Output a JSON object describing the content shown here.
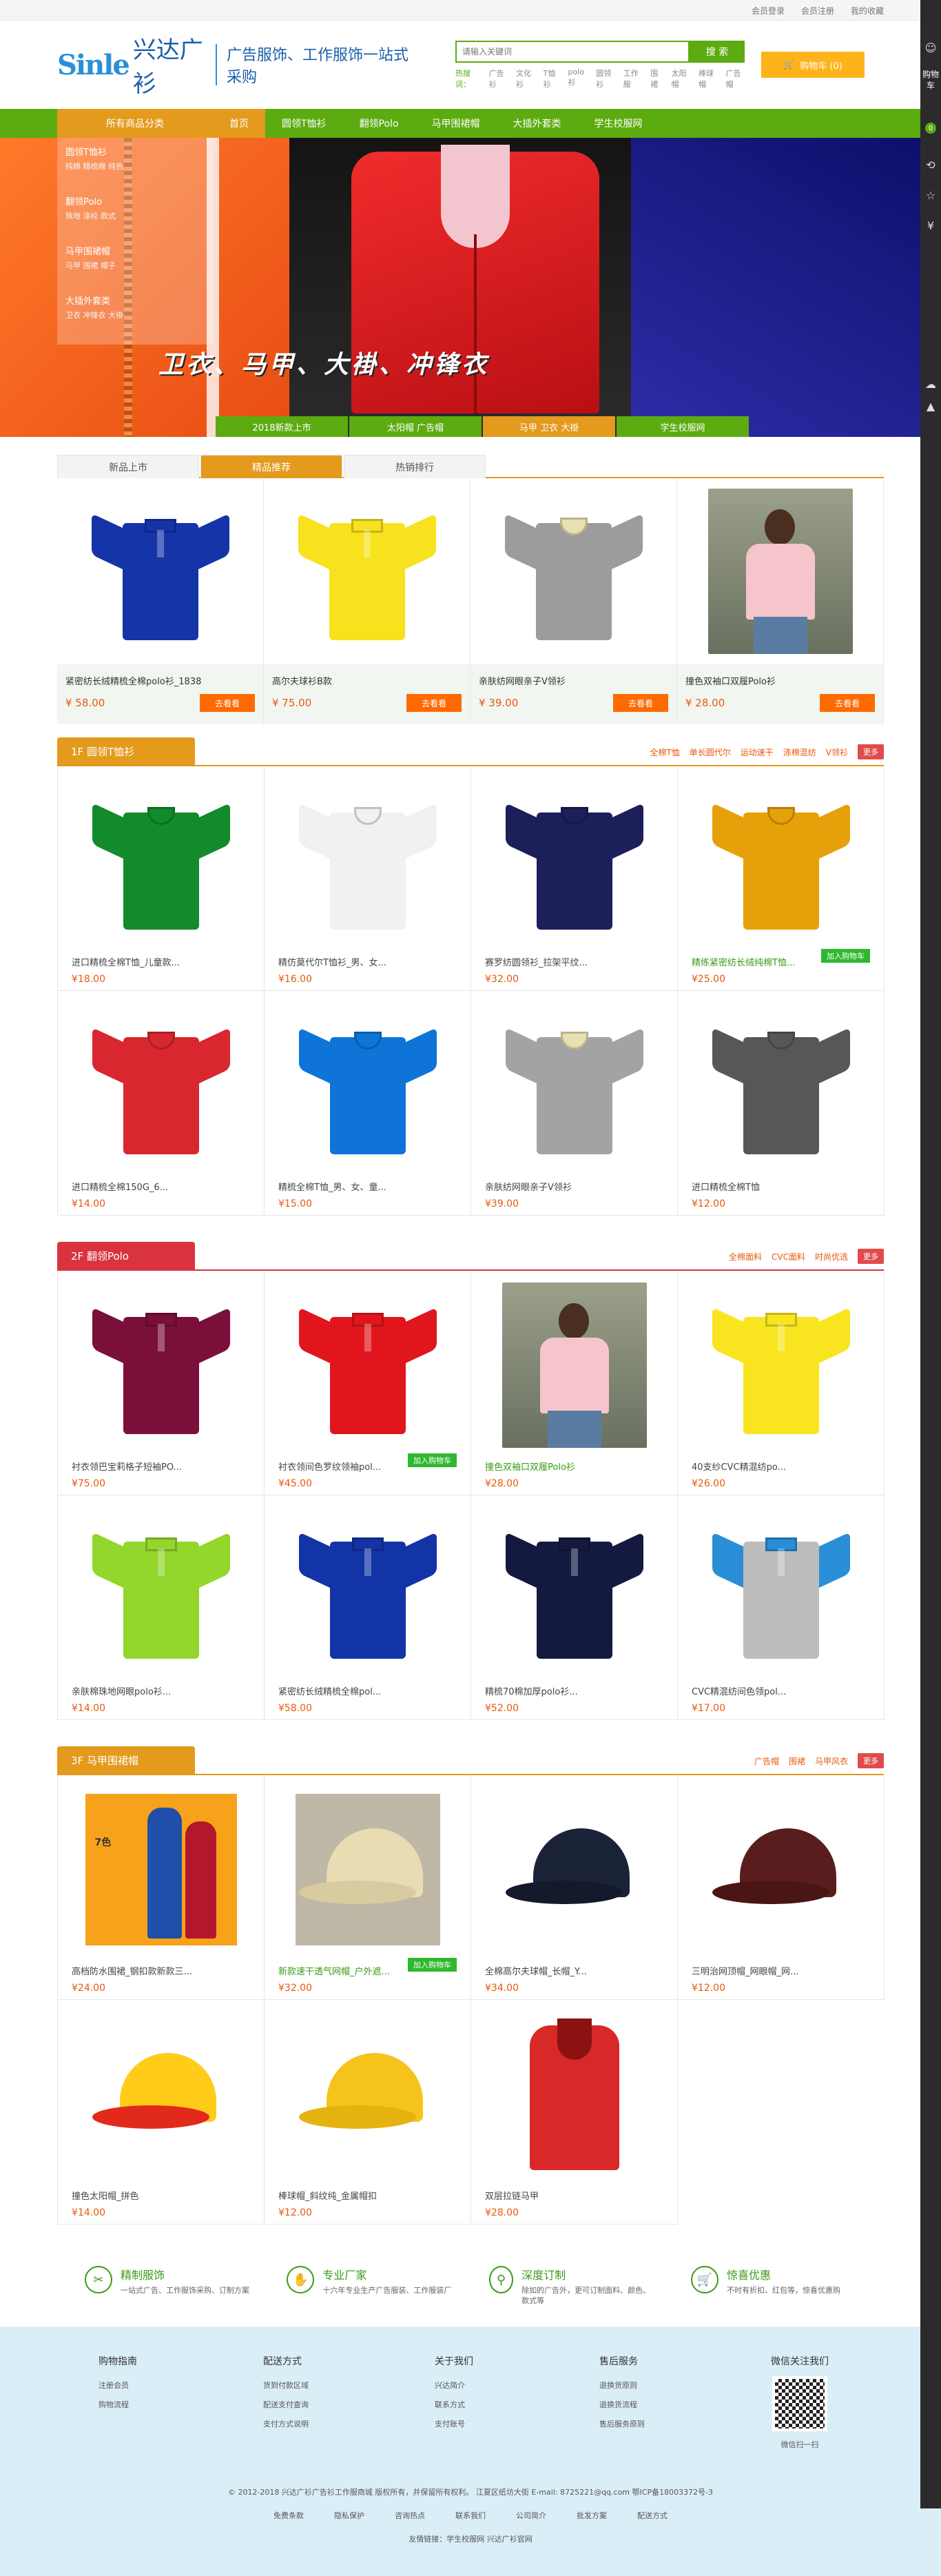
{
  "topbar": {
    "login": "会员登录",
    "register": "会员注册",
    "favorites": "我的收藏"
  },
  "logo": {
    "mark": "Sinle",
    "cn": "兴达广衫",
    "slogan": "广告服饰、工作服饰一站式采购"
  },
  "search": {
    "placeholder": "请输入关键词",
    "button": "搜 索",
    "hot_label": "热搜词：",
    "hot": [
      "广告衫",
      "文化衫",
      "T恤衫",
      "polo衫",
      "圆领衫",
      "工作服",
      "围裙",
      "太阳帽",
      "棒球帽",
      "广告帽"
    ]
  },
  "cart": {
    "label": "购物车 (0)"
  },
  "nav": {
    "all": "所有商品分类",
    "items": [
      "首页",
      "圆领T恤衫",
      "翻领Polo",
      "马甲围裙帽",
      "大插外套类",
      "学生校服网"
    ]
  },
  "banner": {
    "headline": "卫衣、马甲、大褂、冲锋衣",
    "categories": [
      {
        "title": "圆领T恤衫",
        "sub": "纯棉  精梳棉  纯色"
      },
      {
        "title": "翻领Polo",
        "sub": "珠地  涤纶  款式"
      },
      {
        "title": "马甲围裙帽",
        "sub": "马甲  围裙  帽子"
      },
      {
        "title": "大插外套类",
        "sub": "卫衣  冲锋衣  大褂"
      }
    ],
    "tabs": [
      "2018新款上市",
      "太阳帽 广告帽",
      "马甲 卫衣 大褂",
      "学生校服网"
    ]
  },
  "sidebar": {
    "cart": "购物车",
    "count": "0"
  },
  "tabs": {
    "labels": [
      "新品上市",
      "精品推荐",
      "热销排行"
    ],
    "buy": "去看看",
    "products": [
      {
        "name": "紧密纺长绒精梳全棉polo衫_1838",
        "price": "¥ 58.00"
      },
      {
        "name": "高尔夫球衫B款",
        "price": "¥ 75.00"
      },
      {
        "name": "亲肤纺网眼亲子V领衫",
        "price": "¥ 39.00"
      },
      {
        "name": "撞色双袖口双履Polo衫",
        "price": "¥ 28.00"
      }
    ]
  },
  "floor1": {
    "title": "1F 圆领T恤衫",
    "links": [
      "全棉T恤",
      "单长圆代尔",
      "运动速干",
      "涤棉混纺",
      "V领衫"
    ],
    "more": "更多",
    "add_cart": "加入购物车",
    "products": [
      {
        "name": "进口精梳全棉T恤_儿童款...",
        "price": "¥18.00"
      },
      {
        "name": "精仿莫代尔T恤衫_男、女...",
        "price": "¥16.00"
      },
      {
        "name": "赛罗纺圆领衫_拉架平纹...",
        "price": "¥32.00"
      },
      {
        "name": "精练紧密纺长绒纯棉T恤...",
        "price": "¥25.00"
      },
      {
        "name": "进口精梳全棉150G_6...",
        "price": "¥14.00"
      },
      {
        "name": "精梳全棉T恤_男、女、童...",
        "price": "¥15.00"
      },
      {
        "name": "亲肤纺网眼亲子V领衫",
        "price": "¥39.00"
      },
      {
        "name": "进口精梳全棉T恤",
        "price": "¥12.00"
      }
    ]
  },
  "floor2": {
    "title": "2F 翻领Polo",
    "links": [
      "全棉面料",
      "CVC面料",
      "时尚优选"
    ],
    "more": "更多",
    "add_cart": "加入购物车",
    "products": [
      {
        "name": "衬衣领巴宝莉格子短袖PO...",
        "price": "¥75.00"
      },
      {
        "name": "衬衣领间色罗纹领袖pol...",
        "price": "¥45.00"
      },
      {
        "name": "撞色双袖口双履Polo衫",
        "price": "¥28.00"
      },
      {
        "name": "40支纱CVC精混纺po...",
        "price": "¥26.00"
      },
      {
        "name": "亲肤棉珠地网眼polo衫...",
        "price": "¥14.00"
      },
      {
        "name": "紧密纺长绒精梳全棉pol...",
        "price": "¥58.00"
      },
      {
        "name": "精梳70棉加厚polo衫...",
        "price": "¥52.00"
      },
      {
        "name": "CVC精混纺间色领pol...",
        "price": "¥17.00"
      }
    ]
  },
  "floor3": {
    "title": "3F 马甲围裙帽",
    "links": [
      "广告帽",
      "围裙",
      "马甲风衣"
    ],
    "more": "更多",
    "add_cart": "加入购物车",
    "apron_label": "7色",
    "products": [
      {
        "name": "高档防水围裙_钢扣款新款三...",
        "price": "¥24.00"
      },
      {
        "name": "新款速干透气网帽_户外遮...",
        "price": "¥32.00"
      },
      {
        "name": "全棉高尔夫球帽_长帽_Y...",
        "price": "¥34.00"
      },
      {
        "name": "三明治网顶帽_网眼帽_网...",
        "price": "¥12.00"
      },
      {
        "name": "撞色太阳帽_拼色",
        "price": "¥14.00"
      },
      {
        "name": "棒球帽_斜纹纯_金属帽扣",
        "price": "¥12.00"
      },
      {
        "name": "双层拉链马甲",
        "price": "¥28.00"
      }
    ]
  },
  "services": [
    {
      "title": "精制服饰",
      "desc": "一站式广告、工作服饰采购、订制方案"
    },
    {
      "title": "专业厂家",
      "desc": "十六年专业生产广告服装、工作服装厂"
    },
    {
      "title": "深度订制",
      "desc": "除如的广告外，更可订制面料、颜色、款式等"
    },
    {
      "title": "惊喜优惠",
      "desc": "不时有折扣、红包等，惊喜优惠购"
    }
  ],
  "footer": {
    "cols": [
      {
        "title": "购物指南",
        "links": [
          "注册会员",
          "购物流程"
        ]
      },
      {
        "title": "配送方式",
        "links": [
          "货到付款区域",
          "配送支付查询",
          "支付方式说明"
        ]
      },
      {
        "title": "关于我们",
        "links": [
          "兴达简介",
          "联系方式",
          "支付账号"
        ]
      },
      {
        "title": "售后服务",
        "links": [
          "退换货原则",
          "退换货流程",
          "售后服务原则"
        ]
      }
    ],
    "wechat_title": "微信关注我们",
    "wechat_caption": "微信扫一扫",
    "copyright": "© 2012-2018 兴达广衫广告衫工作服商城 版权所有，并保留所有权利。 江夏区纸坊大街 E-mail: 8725221@qq.com 鄂ICP备18003372号-3",
    "bottom_links": [
      "免费条款",
      "隐私保护",
      "咨询热点",
      "联系我们",
      "公司简介",
      "批发方案",
      "配送方式"
    ],
    "friend": "友情链接：学生校服网  兴达广衫官网"
  }
}
